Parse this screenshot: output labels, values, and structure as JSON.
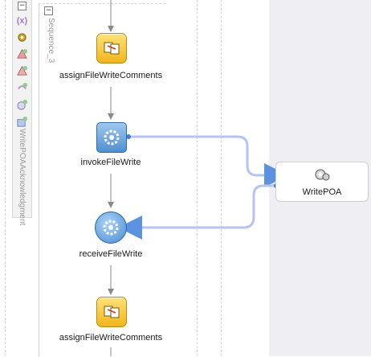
{
  "scope": {
    "name": "WritePOAAcknowledgment",
    "toolbar_icons": [
      "variable-icon",
      "gear-icon",
      "add-catch-icon",
      "add-catch-all-icon",
      "add-compensation-icon",
      "add-event-icon",
      "add-terminate-icon"
    ]
  },
  "sequence": {
    "name": "Sequence_3"
  },
  "activities": [
    {
      "label": "assignFileWriteComments",
      "kind": "assign"
    },
    {
      "label": "invokeFileWrite",
      "kind": "invoke"
    },
    {
      "label": "receiveFileWrite",
      "kind": "receive"
    },
    {
      "label": "assignFileWriteComments",
      "kind": "assign"
    }
  ],
  "partner_link": {
    "label": "WritePOA"
  },
  "colors": {
    "assign_fill": "#f2b51b",
    "invoke_fill": "#4f8fd0",
    "connector": "#b9c3f2",
    "lane_bg": "#efeef3"
  }
}
